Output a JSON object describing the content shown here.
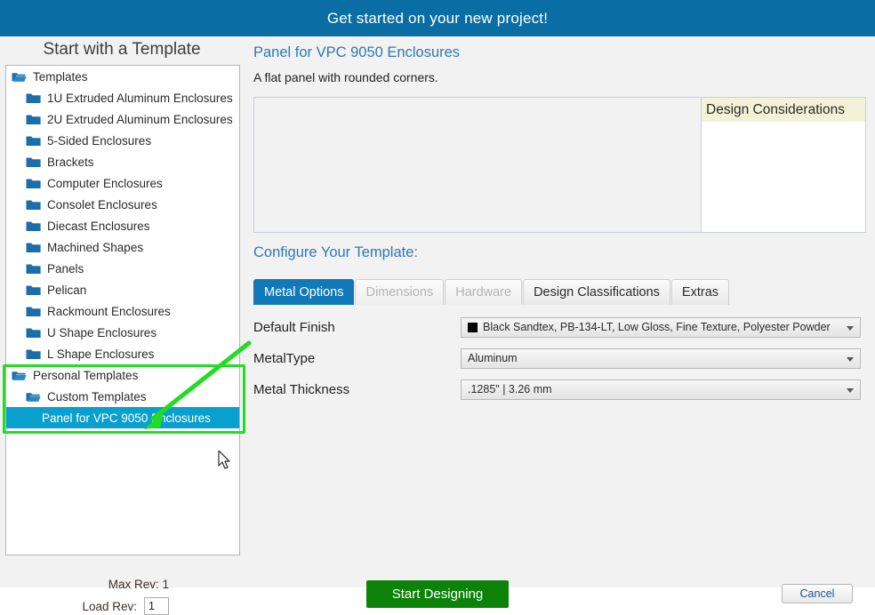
{
  "window": {
    "title": "Get started on your new project!",
    "accent_color": "#0a6ea4",
    "selection_color": "#0aa0ce",
    "annotation_color": "#22dd22"
  },
  "sidebar": {
    "heading": "Start with a Template",
    "tree": [
      {
        "label": "Templates",
        "depth": 0,
        "icon": "open-folder-icon",
        "selected": false
      },
      {
        "label": "1U Extruded Aluminum Enclosures",
        "depth": 1,
        "icon": "folder-icon",
        "selected": false
      },
      {
        "label": "2U Extruded Aluminum Enclosures",
        "depth": 1,
        "icon": "folder-icon",
        "selected": false
      },
      {
        "label": "5-Sided Enclosures",
        "depth": 1,
        "icon": "folder-icon",
        "selected": false
      },
      {
        "label": "Brackets",
        "depth": 1,
        "icon": "folder-icon",
        "selected": false
      },
      {
        "label": "Computer Enclosures",
        "depth": 1,
        "icon": "folder-icon",
        "selected": false
      },
      {
        "label": "Consolet Enclosures",
        "depth": 1,
        "icon": "folder-icon",
        "selected": false
      },
      {
        "label": "Diecast Enclosures",
        "depth": 1,
        "icon": "folder-icon",
        "selected": false
      },
      {
        "label": "Machined Shapes",
        "depth": 1,
        "icon": "folder-icon",
        "selected": false
      },
      {
        "label": "Panels",
        "depth": 1,
        "icon": "folder-icon",
        "selected": false
      },
      {
        "label": "Pelican",
        "depth": 1,
        "icon": "folder-icon",
        "selected": false
      },
      {
        "label": "Rackmount Enclosures",
        "depth": 1,
        "icon": "folder-icon",
        "selected": false
      },
      {
        "label": "U Shape Enclosures",
        "depth": 1,
        "icon": "folder-icon",
        "selected": false
      },
      {
        "label": "L Shape Enclosures",
        "depth": 1,
        "icon": "folder-icon",
        "selected": false
      },
      {
        "label": "Personal Templates",
        "depth": 0,
        "icon": "open-folder-icon",
        "selected": false
      },
      {
        "label": "Custom Templates",
        "depth": 1,
        "icon": "open-folder-icon",
        "selected": false
      },
      {
        "label": "Panel for VPC 9050 Enclosures",
        "depth": 2,
        "icon": "none",
        "selected": true
      }
    ]
  },
  "revision": {
    "max_rev_label": "Max Rev: 1",
    "load_rev_label": "Load Rev:",
    "load_rev_value": "1"
  },
  "detail": {
    "title": "Panel for VPC 9050 Enclosures",
    "subtitle": "A flat panel with rounded corners.",
    "considerations_header": "Design Considerations",
    "considerations_body": "",
    "configure_label": "Configure Your Template:"
  },
  "tabs": [
    {
      "label": "Metal Options",
      "state": "active"
    },
    {
      "label": "Dimensions",
      "state": "disabled"
    },
    {
      "label": "Hardware",
      "state": "disabled"
    },
    {
      "label": "Design Classifications",
      "state": "normal"
    },
    {
      "label": "Extras",
      "state": "normal"
    }
  ],
  "metal_options": {
    "rows": [
      {
        "label": "Default Finish",
        "value": "Black Sandtex, PB-134-LT, Low Gloss, Fine Texture, Polyester Powder",
        "swatch": "#000000",
        "has_swatch": true
      },
      {
        "label": "MetalType",
        "value": "Aluminum",
        "has_swatch": false
      },
      {
        "label": "Metal Thickness",
        "value": ".1285\" | 3.26 mm",
        "has_swatch": false
      }
    ]
  },
  "footer": {
    "start_label": "Start Designing",
    "cancel_label": "Cancel"
  }
}
